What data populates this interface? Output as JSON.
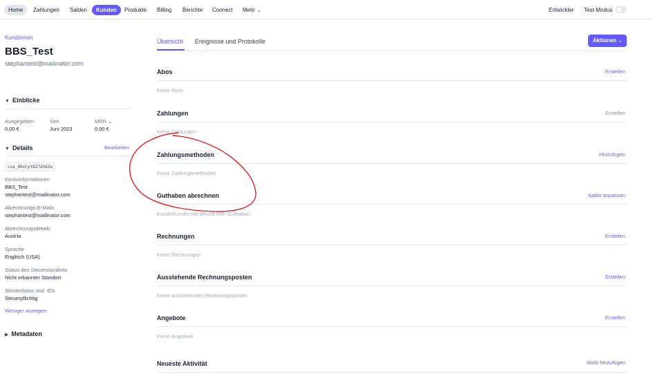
{
  "nav": {
    "items": [
      "Home",
      "Zahlungen",
      "Salden",
      "Kunden",
      "Produkte",
      "Billing",
      "Berichte",
      "Connect",
      "Mehr"
    ],
    "developer": "Entwickler",
    "test_mode": "Test-Modus",
    "test_mode_on": false
  },
  "customer": {
    "eyebrow": "Kund/innen",
    "name": "BBS_Test",
    "email": "stephantest@mailinator.com"
  },
  "insights": {
    "title": "Einblicke",
    "stats": [
      {
        "label": "Ausgegeben",
        "value": "0,00 €"
      },
      {
        "label": "Seit",
        "value": "Juni 2023"
      },
      {
        "label": "MRR",
        "value": "0,00 €"
      }
    ]
  },
  "details": {
    "title": "Details",
    "edit": "Bearbeiten",
    "id": "cus_O6xCyY827dn6Zw",
    "fields": [
      {
        "label": "Kontoinformationen",
        "lines": [
          "BBS_Test",
          "stephantest@mailinator.com"
        ]
      },
      {
        "label": "Abrechnungs-E-Mails",
        "lines": [
          "stephantest@mailinator.com"
        ]
      },
      {
        "label": "Abrechnungsdetails",
        "lines": [
          "Austria"
        ]
      },
      {
        "label": "Sprache",
        "lines": [
          "Englisch (USA)"
        ]
      },
      {
        "label": "Status des Steuerstandorts",
        "lines": [
          "Nicht erkannter Standort"
        ]
      },
      {
        "label": "Steuerstatus und -IDs",
        "lines": [
          "Steuerpflichtig"
        ]
      }
    ],
    "show_less": "Weniger anzeigen"
  },
  "metadata": {
    "title": "Metadaten"
  },
  "tabs": [
    "Übersicht",
    "Ereignisse und Protokolle"
  ],
  "actions_label": "Aktionen",
  "sections": [
    {
      "title": "Abos",
      "action": "Erstellen",
      "empty": "Keine Abos",
      "action_enabled": true
    },
    {
      "title": "Zahlungen",
      "action": "Erstellen",
      "empty": "Keine Zahlungen",
      "action_enabled": false
    },
    {
      "title": "Zahlungsmethoden",
      "action": "Hinzufügen",
      "empty": "Keine Zahlungsmethoden",
      "action_enabled": true
    },
    {
      "title": "Guthaben abrechnen",
      "action": "Saldo anpassen",
      "empty": "Kunde/Kundin hat derzeit kein Guthaben.",
      "action_enabled": true
    },
    {
      "title": "Rechnungen",
      "action": "Erstellen",
      "empty": "Keine Rechnungen",
      "action_enabled": true
    },
    {
      "title": "Ausstehende Rechnungsposten",
      "action": "Erstellen",
      "empty": "Keine ausstehenden Rechnungsposten",
      "action_enabled": true
    },
    {
      "title": "Angebote",
      "action": "Erstellen",
      "empty": "Keine Angebote",
      "action_enabled": true
    },
    {
      "title": "Neueste Aktivität",
      "action": "Notiz hinzufügen",
      "empty": "",
      "action_enabled": true
    }
  ],
  "colors": {
    "accent": "#635bff",
    "text": "#1a1f36",
    "muted": "#697386",
    "annotation": "#e02020"
  },
  "icons": {
    "chevron_down": "chevron-down-icon",
    "caret_down": "caret-down-icon",
    "caret_right": "caret-right-icon"
  }
}
